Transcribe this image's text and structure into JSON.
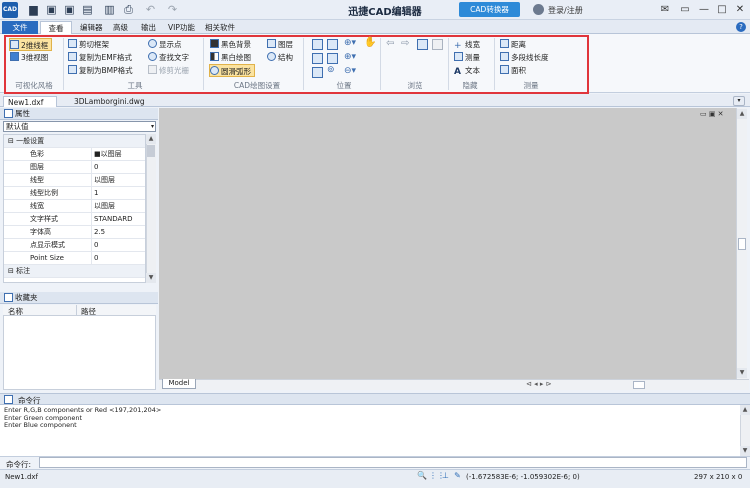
{
  "title_bar": {
    "logo_text": "CAD",
    "app_title": "迅捷CAD编辑器",
    "converter_label": "CAD转换器",
    "login_label": "登录/注册",
    "quick_access": [
      "folder-icon",
      "save-icon",
      "print-icon",
      "undo-icon",
      "redo-icon"
    ]
  },
  "menu": {
    "file": "文件",
    "tabs": [
      "查看器",
      "编辑器",
      "高级",
      "输出",
      "VIP功能",
      "相关软件"
    ],
    "help": "?"
  },
  "ribbon": {
    "style_group": {
      "label": "可视化风格",
      "items": [
        "2维线框",
        "3维视图"
      ]
    },
    "tools_group": {
      "label": "工具",
      "col1": [
        "剪切框架",
        "复制为EMF格式",
        "复制为BMP格式"
      ],
      "col2": [
        "显示点",
        "查找文字",
        "修剪光栅"
      ]
    },
    "draw_group": {
      "label": "CAD绘图设置",
      "col1": [
        "黑色背景",
        "黑白绘图",
        "圆滑弧形"
      ],
      "col2": [
        "图层",
        "结构"
      ]
    },
    "position_group": {
      "label": "位置"
    },
    "browse_group": {
      "label": "浏览"
    },
    "hide_group": {
      "label": "隐藏",
      "items": [
        "线宽",
        "测量",
        "文本"
      ]
    },
    "measure_group": {
      "label": "测量",
      "items": [
        "距离",
        "多段线长度",
        "面积"
      ]
    }
  },
  "documents": {
    "tabs": [
      "New1.dxf",
      "3DLamborgini.dwg"
    ]
  },
  "properties": {
    "title": "属性",
    "selector": "默认值",
    "category": "一般设置",
    "rows": [
      {
        "key": "色彩",
        "value": "■以图层"
      },
      {
        "key": "图层",
        "value": "0"
      },
      {
        "key": "线型",
        "value": "以图层"
      },
      {
        "key": "线型比例",
        "value": "1"
      },
      {
        "key": "线宽",
        "value": "以图层"
      },
      {
        "key": "文字样式",
        "value": "STANDARD"
      },
      {
        "key": "字体高",
        "value": "2.5"
      },
      {
        "key": "点显示模式",
        "value": "0"
      },
      {
        "key": "Point Size",
        "value": "0"
      }
    ],
    "category2": "标注"
  },
  "favorites": {
    "title": "收藏夹",
    "col_name": "名称",
    "col_path": "路径"
  },
  "canvas": {
    "model_tab": "Model"
  },
  "command": {
    "title": "命令行",
    "log": [
      "Enter R,G,B components or Red <197,201,204>",
      "Enter Green component",
      "Enter Blue component"
    ],
    "prompt": "命令行:"
  },
  "status": {
    "file": "New1.dxf",
    "coord": "(-1.672583E-6; -1.059302E-6; 0)",
    "paper": "297 x 210 x 0"
  }
}
